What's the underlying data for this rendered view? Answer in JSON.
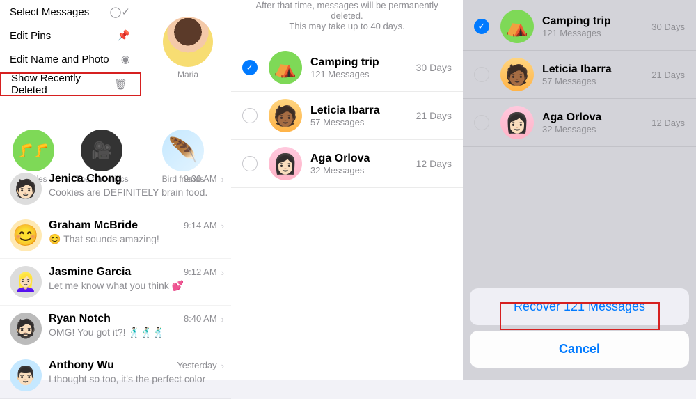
{
  "panel1": {
    "menu": {
      "select_messages": "Select Messages",
      "edit_pins": "Edit Pins",
      "edit_name_photo": "Edit Name and Photo",
      "show_recently_deleted": "Show Recently Deleted"
    },
    "pins": {
      "maria": "Maria",
      "besties": "Besties",
      "film": "The film critics",
      "bird": "Bird friends"
    },
    "chats": [
      {
        "name": "Jenica Chong",
        "time": "9:30 AM",
        "msg": "Cookies are DEFINITELY brain food."
      },
      {
        "name": "Graham McBride",
        "time": "9:14 AM",
        "msg": "😊 That sounds amazing!"
      },
      {
        "name": "Jasmine Garcia",
        "time": "9:12 AM",
        "msg": "Let me know what you think 💕"
      },
      {
        "name": "Ryan Notch",
        "time": "8:40 AM",
        "msg": "OMG! You got it?! 🕺🏻🕺🏻🕺🏻"
      },
      {
        "name": "Anthony Wu",
        "time": "Yesterday",
        "msg": "I thought so too, it's the perfect color"
      }
    ]
  },
  "panel2": {
    "info_line1": "After that time, messages will be permanently deleted.",
    "info_line2": "This may take up to 40 days.",
    "items": [
      {
        "name": "Camping trip",
        "count": "121 Messages",
        "days": "30 Days",
        "selected": true
      },
      {
        "name": "Leticia Ibarra",
        "count": "57 Messages",
        "days": "21 Days",
        "selected": false
      },
      {
        "name": "Aga Orlova",
        "count": "32 Messages",
        "days": "12 Days",
        "selected": false
      }
    ]
  },
  "panel3": {
    "items": [
      {
        "name": "Camping trip",
        "count": "121 Messages",
        "days": "30 Days",
        "selected": true
      },
      {
        "name": "Leticia Ibarra",
        "count": "57 Messages",
        "days": "21 Days",
        "selected": false
      },
      {
        "name": "Aga Orlova",
        "count": "32 Messages",
        "days": "12 Days",
        "selected": false
      }
    ],
    "recover_btn": "Recover 121 Messages",
    "cancel_btn": "Cancel"
  }
}
